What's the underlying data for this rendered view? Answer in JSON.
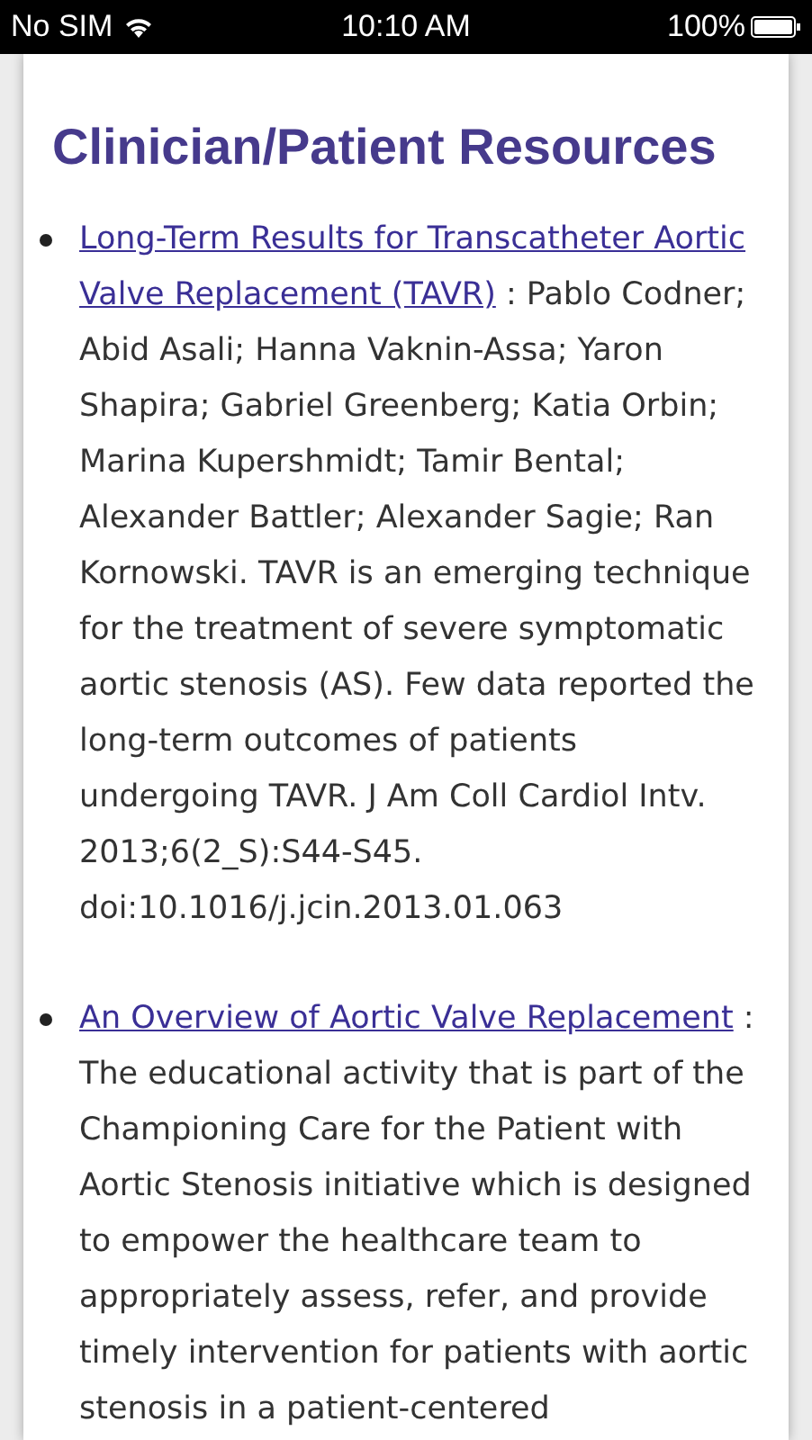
{
  "status_bar": {
    "carrier": "No SIM",
    "time": "10:10 AM",
    "battery": "100%"
  },
  "heading": "Clinician/Patient Resources",
  "resources": [
    {
      "link": "Long-Term Results for Transcatheter Aortic Valve Replacement (TAVR)",
      "description": " : Pablo Codner; Abid Asali; Hanna Vaknin-Assa; Yaron Shapira; Gabriel Greenberg; Katia Orbin; Marina Kupershmidt; Tamir Bental; Alexander Battler; Alexander Sagie; Ran Kornowski. TAVR is an emerging technique for the treatment of severe symptomatic aortic stenosis (AS). Few data reported the long-term outcomes of patients undergoing TAVR. J Am Coll Cardiol Intv. 2013;6(2_S):S44-S45. doi:10.1016/j.jcin.2013.01.063"
    },
    {
      "link": "An Overview of Aortic Valve Replacement",
      "description": " : The educational activity that is part of the Championing Care for the Patient with Aortic Stenosis initiative which is designed to empower the healthcare team to appropriately assess, refer, and provide timely intervention for patients with aortic stenosis in a patient-centered"
    }
  ]
}
